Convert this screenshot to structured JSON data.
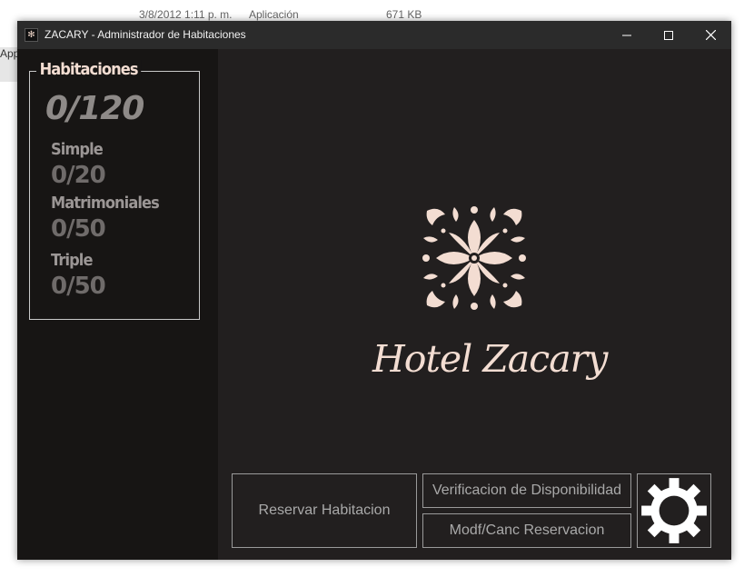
{
  "background": {
    "date": "3/8/2012 1:11 p. m.",
    "type": "Aplicación",
    "size": "671 KB",
    "left_label": "App"
  },
  "window": {
    "title": "ZACARY - Administrador de Habitaciones"
  },
  "sidebar": {
    "group_title": "Habitaciones",
    "total": "0/120",
    "categories": [
      {
        "label": "Simple",
        "value": "0/20"
      },
      {
        "label": "Matrimoniales",
        "value": "0/50"
      },
      {
        "label": "Triple",
        "value": "0/50"
      }
    ]
  },
  "logo": {
    "name": "Hotel Zacary"
  },
  "buttons": {
    "reservar": "Reservar Habitacion",
    "verificacion": "Verificacion de Disponibilidad",
    "modificar": "Modf/Canc Reservacion"
  },
  "colors": {
    "background": "#221f1f",
    "sidebar": "#171514",
    "accent": "#f3ddd2",
    "button_text": "#a9a9a9"
  },
  "icons": [
    "flower-ornament-icon",
    "gear-icon",
    "minimize-icon",
    "maximize-icon",
    "close-icon"
  ]
}
